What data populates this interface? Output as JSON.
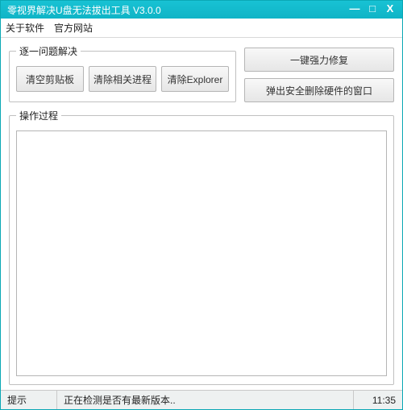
{
  "window": {
    "title": "零视界解决U盘无法拔出工具 V3.0.0"
  },
  "menu": {
    "about": "关于软件",
    "website": "官方网站"
  },
  "groups": {
    "stepwise_title": "逐一问题解决",
    "log_title": "操作过程"
  },
  "buttons": {
    "clear_clipboard": "清空剪贴板",
    "clear_processes": "清除相关进程",
    "clear_explorer": "清除Explorer",
    "force_fix": "一键强力修复",
    "eject_dialog": "弹出安全删除硬件的窗口"
  },
  "status": {
    "label": "提示",
    "message": "正在检测是否有最新版本..",
    "time": "11:35"
  }
}
